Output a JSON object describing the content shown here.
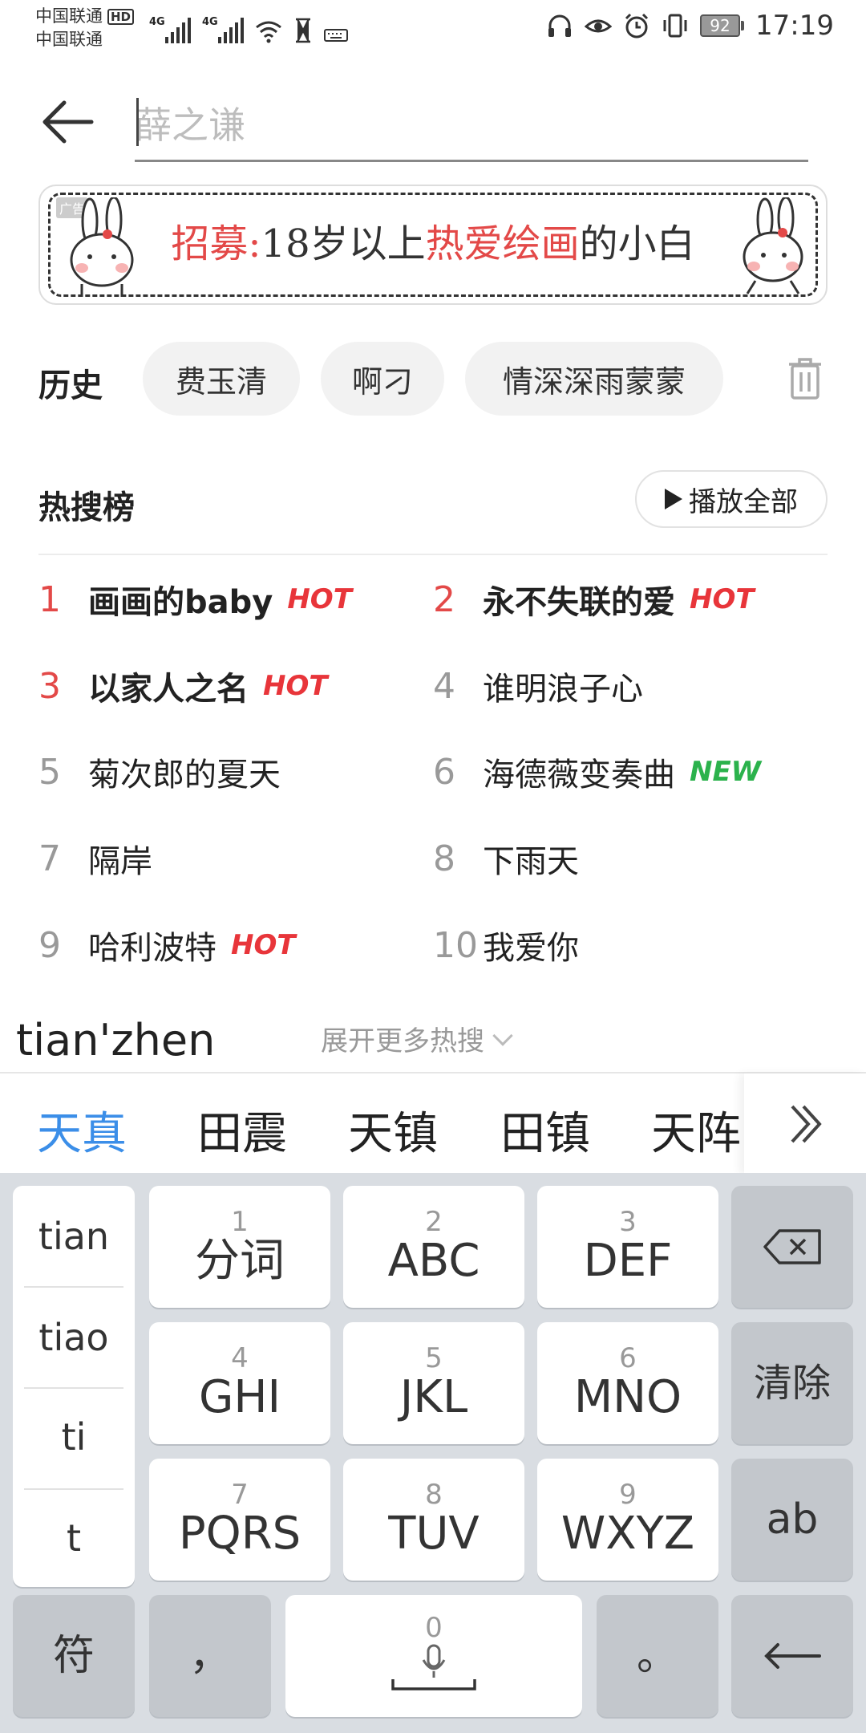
{
  "status_bar": {
    "carrier1": "中国联通",
    "carrier1_badge": "HD",
    "carrier2": "中国联通",
    "signal1_label": "4G",
    "signal2_label": "4G",
    "battery": "92",
    "time": "17:19"
  },
  "search": {
    "placeholder": "薛之谦"
  },
  "banner": {
    "text_red1": "招募:",
    "text_black1": "18岁以上",
    "text_red2": "热爱绘画",
    "text_black2": "的小白",
    "ad_tag": "广告"
  },
  "history": {
    "label": "历史",
    "items": [
      "费玉清",
      "啊刁",
      "情深深雨蒙蒙"
    ]
  },
  "hot_search": {
    "title": "热搜榜",
    "play_all": "播放全部",
    "items": [
      {
        "rank": "1",
        "text": "画画的baby",
        "tag": "HOT"
      },
      {
        "rank": "2",
        "text": "永不失联的爱",
        "tag": "HOT"
      },
      {
        "rank": "3",
        "text": "以家人之名",
        "tag": "HOT"
      },
      {
        "rank": "4",
        "text": "谁明浪子心",
        "tag": ""
      },
      {
        "rank": "5",
        "text": "菊次郎的夏天",
        "tag": ""
      },
      {
        "rank": "6",
        "text": "海德薇变奏曲",
        "tag": "NEW"
      },
      {
        "rank": "7",
        "text": "隔岸",
        "tag": ""
      },
      {
        "rank": "8",
        "text": "下雨天",
        "tag": ""
      },
      {
        "rank": "9",
        "text": "哈利波特",
        "tag": "HOT"
      },
      {
        "rank": "10",
        "text": "我爱你",
        "tag": ""
      }
    ],
    "expand_more": "展开更多热搜"
  },
  "ime": {
    "composing": "tian'zhen",
    "candidates": [
      "天真",
      "田震",
      "天镇",
      "田镇",
      "天阵"
    ],
    "pinyin_options": [
      "tian",
      "tiao",
      "ti",
      "t"
    ],
    "keys": [
      {
        "num": "1",
        "label": "分词"
      },
      {
        "num": "2",
        "label": "ABC"
      },
      {
        "num": "3",
        "label": "DEF"
      },
      {
        "num": "4",
        "label": "GHI"
      },
      {
        "num": "5",
        "label": "JKL"
      },
      {
        "num": "6",
        "label": "MNO"
      },
      {
        "num": "7",
        "label": "PQRS"
      },
      {
        "num": "8",
        "label": "TUV"
      },
      {
        "num": "9",
        "label": "WXYZ"
      }
    ],
    "clear": "清除",
    "ab": "ab",
    "symbol": "符",
    "comma": "，",
    "space_num": "0",
    "period": "。"
  },
  "colors": {
    "accent_red": "#e34948",
    "hot_red": "#e8353a",
    "new_green": "#2bb24c",
    "candidate_blue": "#3b8ee8"
  }
}
